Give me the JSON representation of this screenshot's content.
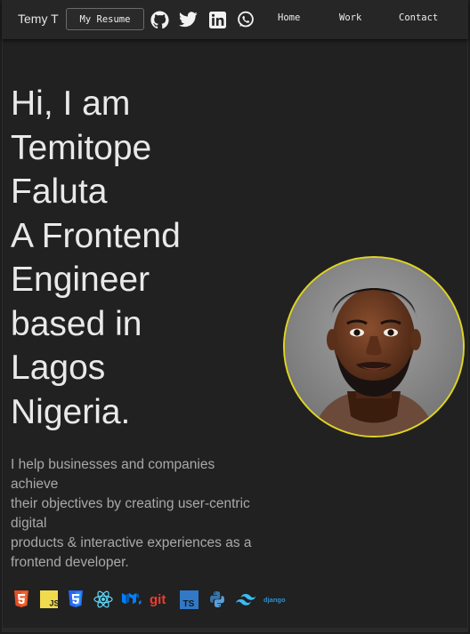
{
  "nav": {
    "brand": "Temy T",
    "resume_label": "My Resume",
    "socials": [
      "github-icon",
      "twitter-icon",
      "linkedin-icon",
      "whatsapp-icon"
    ],
    "links": [
      "Home",
      "Work",
      "Contact"
    ]
  },
  "hero": {
    "lines": [
      "Hi, I am",
      "Temitope",
      "Faluta",
      "A Frontend",
      "Engineer",
      "based in",
      "Lagos",
      "Nigeria."
    ]
  },
  "intro": {
    "lines": [
      "I help businesses and companies",
      "achieve",
      "their objectives by creating user-centric",
      "digital",
      "products & interactive experiences as a",
      "frontend developer."
    ]
  },
  "tech_stack": {
    "icons": [
      "html5-icon",
      "javascript-icon",
      "css3-icon",
      "react-icon",
      "mui-icon",
      "git-icon",
      "typescript-icon",
      "python-icon",
      "tailwind-icon",
      "django-icon"
    ],
    "js_label": "JS",
    "git_label": "git",
    "ts_label": "TS",
    "django_label": "django"
  },
  "colors": {
    "background": "#212121",
    "navbar": "#262626",
    "avatar_ring": "#e0d41f",
    "html5": "#e34f26",
    "javascript": "#f0db4f",
    "css3": "#2965f1",
    "react": "#61dafb",
    "mui": "#007fff",
    "git": "#f03c2e",
    "typescript": "#3178c6",
    "python": "#3776ab",
    "tailwind": "#38bdf8",
    "django": "#2f8fd1"
  }
}
